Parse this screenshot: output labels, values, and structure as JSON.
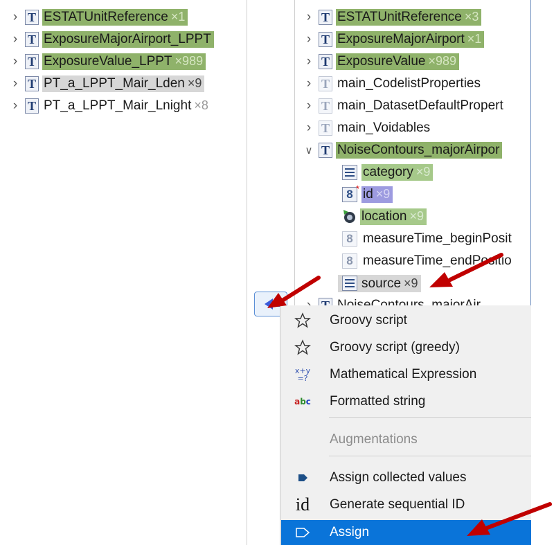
{
  "left_tree": [
    {
      "label": "ESTATUnitReference",
      "count": "×1",
      "style": "green",
      "chevron": "›"
    },
    {
      "label": "ExposureMajorAirport_LPPT",
      "count": "",
      "style": "green",
      "chevron": "›"
    },
    {
      "label": "ExposureValue_LPPT",
      "count": "×989",
      "style": "green",
      "chevron": "›"
    },
    {
      "label": "PT_a_LPPT_Mair_Lden",
      "count": "×9",
      "style": "grey",
      "chevron": "›"
    },
    {
      "label": "PT_a_LPPT_Mair_Lnight",
      "count": "×8",
      "style": "none",
      "chevron": "›"
    }
  ],
  "right_tree": [
    {
      "label": "ESTATUnitReference",
      "count": "×3",
      "style": "green",
      "chevron": "›",
      "icon": "type-icon"
    },
    {
      "label": "ExposureMajorAirport",
      "count": "×1",
      "style": "green",
      "chevron": "›",
      "icon": "type-icon"
    },
    {
      "label": "ExposureValue",
      "count": "×989",
      "style": "green",
      "chevron": "›",
      "icon": "type-icon"
    },
    {
      "label": "main_CodelistProperties",
      "count": "",
      "style": "none",
      "chevron": "›",
      "icon": "type-icon-dim"
    },
    {
      "label": "main_DatasetDefaultPropert",
      "count": "",
      "style": "none",
      "chevron": "›",
      "icon": "type-icon-dim"
    },
    {
      "label": "main_Voidables",
      "count": "",
      "style": "none",
      "chevron": "›",
      "icon": "type-icon-dim"
    },
    {
      "label": "NoiseContours_majorAirpor",
      "count": "",
      "style": "green",
      "chevron": "⌄",
      "icon": "type-icon"
    },
    {
      "label": "category",
      "count": "×9",
      "style": "lgreen",
      "chevron": "",
      "icon": "list-icon"
    },
    {
      "label": "id",
      "count": "×9",
      "style": "purple",
      "chevron": "",
      "icon": "id-number-icon"
    },
    {
      "label": "location",
      "count": "×9",
      "style": "lgreen",
      "chevron": "",
      "icon": "geometry-icon"
    },
    {
      "label": "measureTime_beginPosit",
      "count": "",
      "style": "none",
      "chevron": "",
      "icon": "number-icon"
    },
    {
      "label": "measureTime_endPositio",
      "count": "",
      "style": "none",
      "chevron": "",
      "icon": "number-icon"
    },
    {
      "label": "source",
      "count": "×9",
      "style": "grey",
      "chevron": "",
      "icon": "list-icon"
    },
    {
      "label": "NoiseContours_majorAir",
      "count": "",
      "style": "none",
      "chevron": "›",
      "icon": "type-icon"
    }
  ],
  "menu": {
    "items": [
      {
        "label": "Groovy script",
        "icon": "star-outline-icon"
      },
      {
        "label": "Groovy script (greedy)",
        "icon": "star-outline-icon"
      },
      {
        "label": "Mathematical Expression",
        "icon": "math-expression-icon"
      },
      {
        "label": "Formatted string",
        "icon": "abc-icon"
      },
      {
        "label": "Augmentations",
        "icon": "",
        "disabled": true
      },
      {
        "label": "Assign collected values",
        "icon": "assign-small-icon"
      },
      {
        "label": "Generate sequential ID",
        "icon": "id-text-icon"
      },
      {
        "label": "Assign",
        "icon": "assign-icon",
        "selected": true
      }
    ],
    "icon_text": {
      "math": "x+y\n=?",
      "abc": "abc",
      "id": "id"
    }
  },
  "colors": {
    "green": "#8fb26a",
    "light_green": "#a6c98a",
    "grey": "#d7d7d7",
    "purple": "#9d9be0",
    "selection": "#0a74d9",
    "arrow": "#c00000"
  }
}
